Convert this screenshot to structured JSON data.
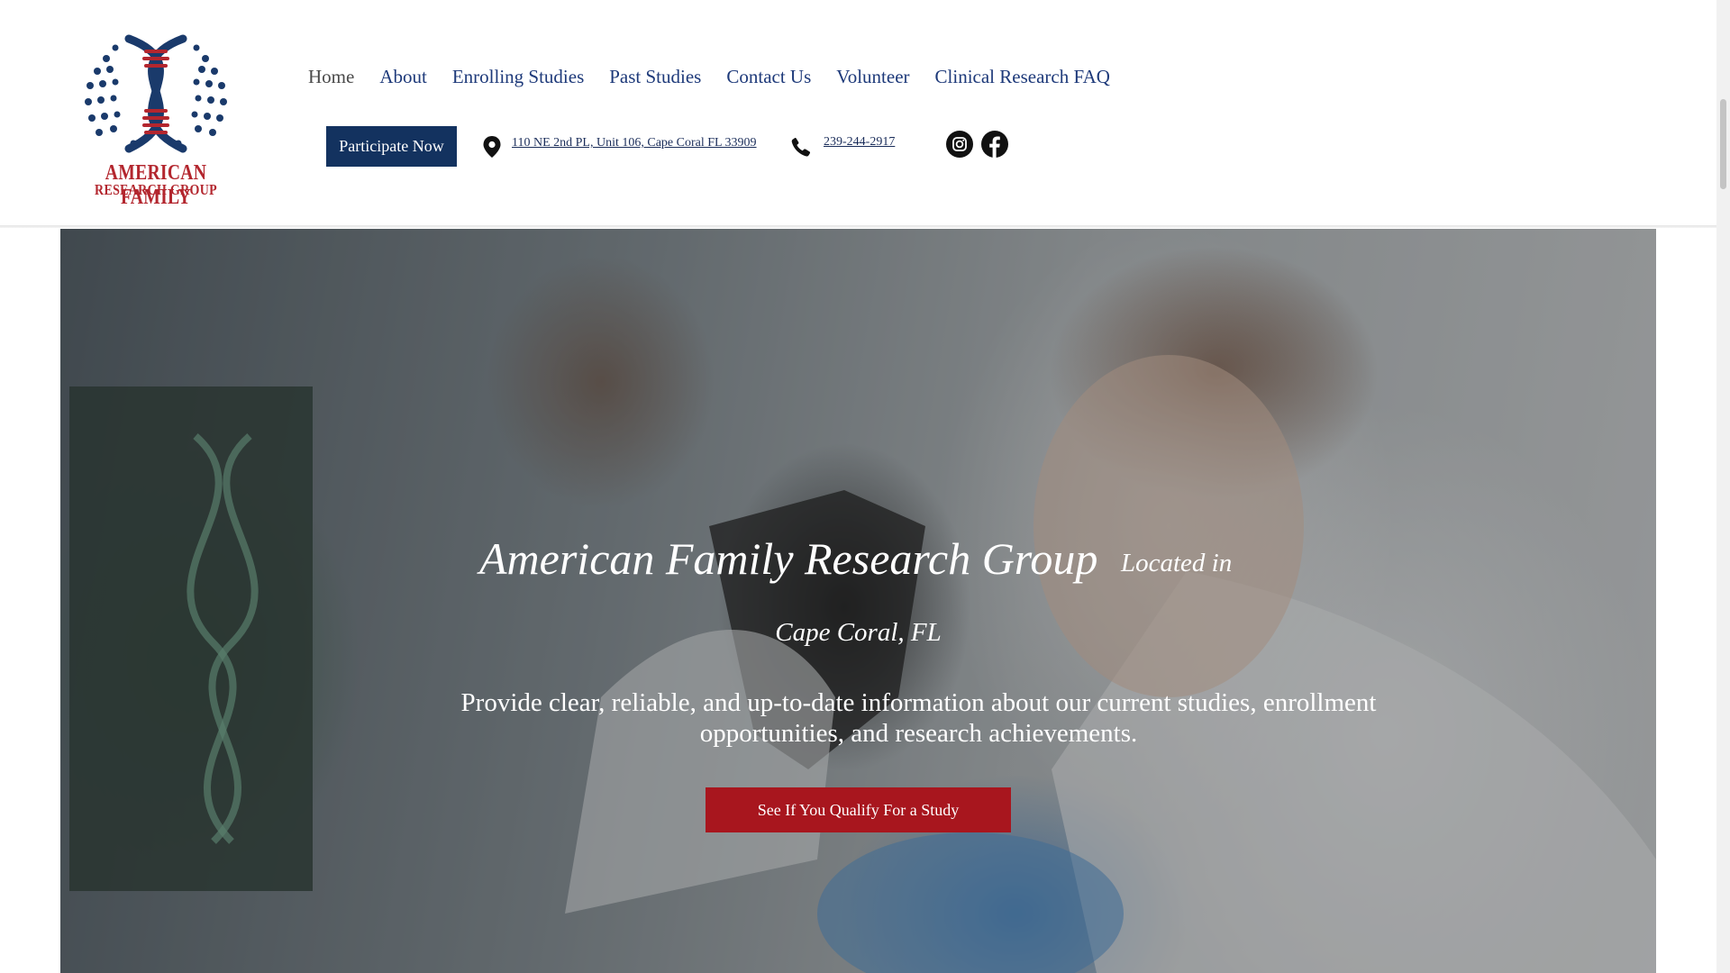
{
  "logo": {
    "line1": "AMERICAN FAMILY",
    "line2": "RESEARCH GROUP",
    "colors": {
      "navy": "#1a3a6b",
      "red": "#b3262e"
    }
  },
  "nav": {
    "items": [
      {
        "label": "Home"
      },
      {
        "label": "About"
      },
      {
        "label": "Enrolling Studies"
      },
      {
        "label": "Past Studies"
      },
      {
        "label": "Contact Us"
      },
      {
        "label": "Volunteer"
      },
      {
        "label": "Clinical Research FAQ"
      }
    ]
  },
  "header": {
    "participate_label": "Participate Now",
    "address": "110 NE 2nd PL, Unit 106, Cape Coral FL 33909",
    "phone": "239-244-2917",
    "social": [
      "instagram-icon",
      "facebook-icon"
    ]
  },
  "hero": {
    "title": "American Family Research Group",
    "located": "Located in",
    "city": "Cape Coral, FL",
    "description": "Provide clear, reliable, and up-to-date information about our current studies, enrollment opportunities, and research achievements.",
    "cta_label": "See If You Qualify For a Study",
    "cta_color": "#a8161e"
  }
}
